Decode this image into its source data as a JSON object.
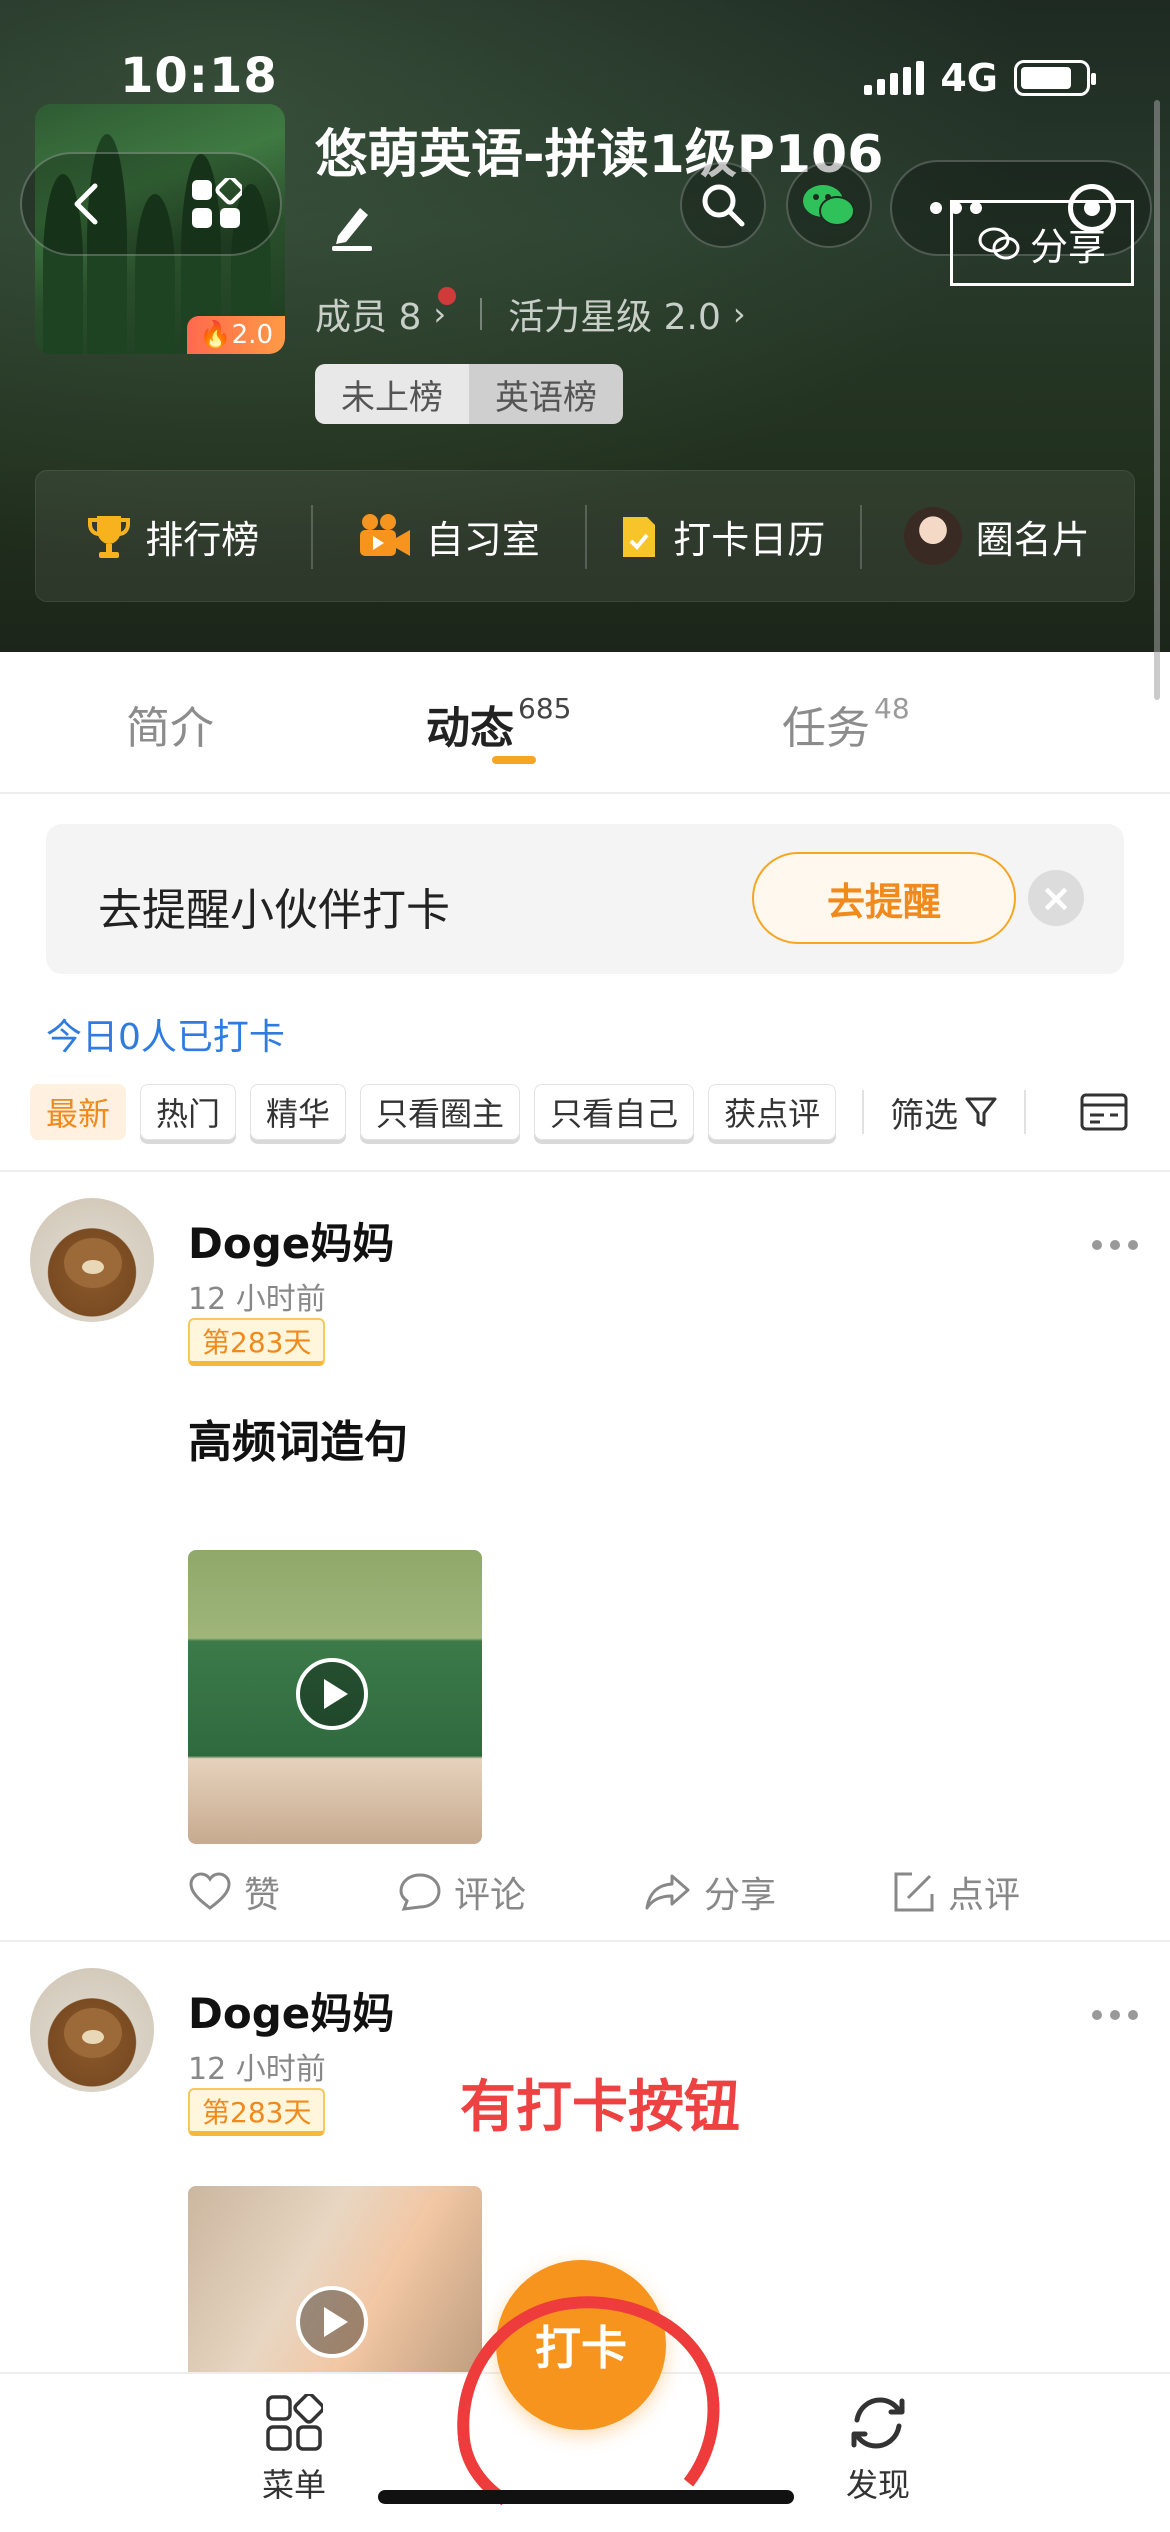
{
  "status": {
    "time": "10:18",
    "network": "4G"
  },
  "group": {
    "title": "悠萌英语-拼读1级P106",
    "level_badge": "2.0",
    "members_label": "成员 8",
    "vitality_label": "活力星级 2.0",
    "rank_tags": [
      "未上榜",
      "英语榜"
    ]
  },
  "header_actions": {
    "share_label": "分享"
  },
  "quick_bar": [
    {
      "label": "排行榜",
      "icon": "trophy-icon"
    },
    {
      "label": "自习室",
      "icon": "video-camera-icon"
    },
    {
      "label": "打卡日历",
      "icon": "calendar-note-icon"
    },
    {
      "label": "圈名片",
      "icon": "avatar-icon"
    }
  ],
  "tabs": [
    {
      "label": "简介",
      "count": ""
    },
    {
      "label": "动态",
      "count": "685"
    },
    {
      "label": "任务",
      "count": "48"
    }
  ],
  "reminder": {
    "text": "去提醒小伙伴打卡",
    "button": "去提醒"
  },
  "today_status": "今日0人已打卡",
  "filters": {
    "chips": [
      "最新",
      "热门",
      "精华",
      "只看圈主",
      "只看自己",
      "获点评"
    ],
    "filter_label": "筛选"
  },
  "posts": [
    {
      "user": "Doge妈妈",
      "time": "12 小时前",
      "badge": "第283天",
      "text": "高频词造句",
      "actions": [
        "赞",
        "评论",
        "分享",
        "点评"
      ]
    },
    {
      "user": "Doge妈妈",
      "time": "12 小时前",
      "badge": "第283天"
    }
  ],
  "annotation": "有打卡按钮",
  "bottom_bar": {
    "menu": "菜单",
    "checkin": "打卡",
    "discover": "发现"
  },
  "colors": {
    "accent": "#f7941d",
    "link": "#2f7be0",
    "annotation": "#ee4242"
  }
}
